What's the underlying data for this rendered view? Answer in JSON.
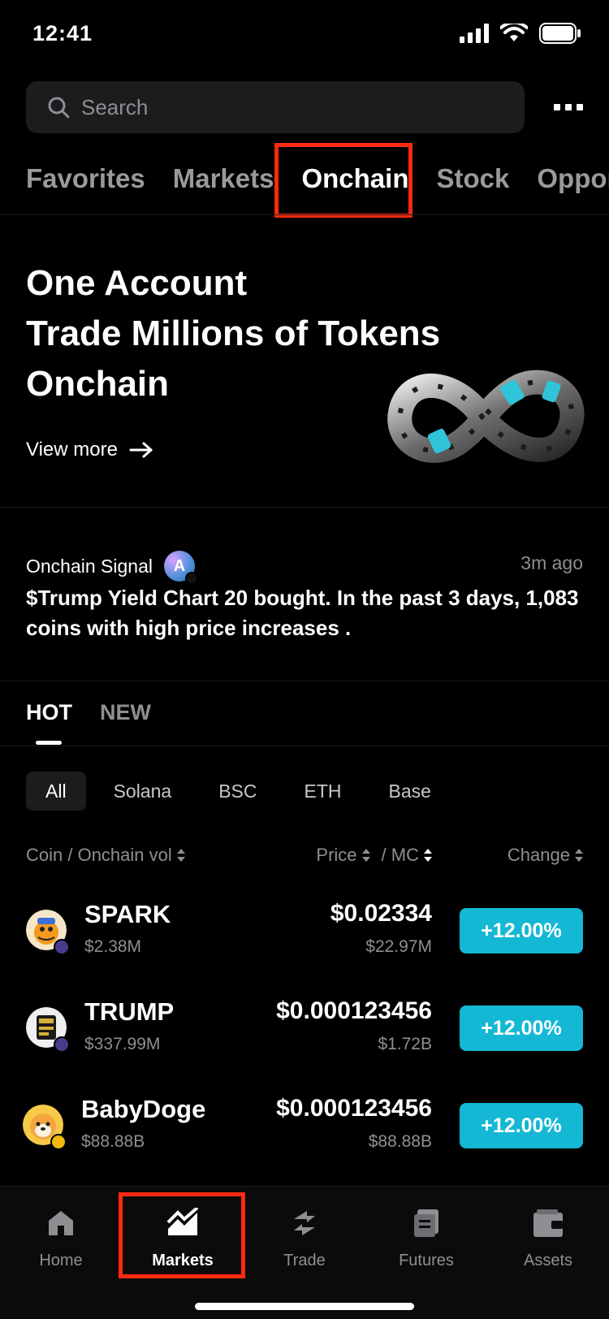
{
  "status_bar": {
    "time": "12:41"
  },
  "search": {
    "placeholder": "Search"
  },
  "top_tabs": [
    "Favorites",
    "Markets",
    "Onchain",
    "Stock",
    "Opportu"
  ],
  "hero": {
    "title_lines": [
      "One Account",
      "Trade Millions of Tokens",
      "Onchain"
    ],
    "view_more": "View more"
  },
  "signal": {
    "label": "Onchain Signal",
    "avatar_letter": "A",
    "time": "3m ago",
    "text": "$Trump Yield Chart 20 bought. In the past 3 days, 1,083 coins with high price increases ."
  },
  "list_tabs": [
    "HOT",
    "NEW"
  ],
  "chains": [
    "All",
    "Solana",
    "BSC",
    "ETH",
    "Base"
  ],
  "columns": {
    "coin": "Coin / Onchain vol",
    "price": "Price",
    "mc": "/ MC",
    "change": "Change"
  },
  "coins": [
    {
      "name": "SPARK",
      "vol": "$2.38M",
      "price": "$0.02334",
      "mc": "$22.97M",
      "change": "+12.00%",
      "icon": "spark-coin-icon",
      "chain": "solana"
    },
    {
      "name": "TRUMP",
      "vol": "$337.99M",
      "price": "$0.000123456",
      "mc": "$1.72B",
      "change": "+12.00%",
      "icon": "trump-coin-icon",
      "chain": "solana"
    },
    {
      "name": "BabyDoge",
      "vol": "$88.88B",
      "price": "$0.000123456",
      "mc": "$88.88B",
      "change": "+12.00%",
      "icon": "babydoge-coin-icon",
      "chain": "bsc"
    }
  ],
  "bottom_nav": [
    "Home",
    "Markets",
    "Trade",
    "Futures",
    "Assets"
  ],
  "colors": {
    "accent": "#14b8d4",
    "highlight": "#ff2a10",
    "muted": "#8e8e93"
  }
}
